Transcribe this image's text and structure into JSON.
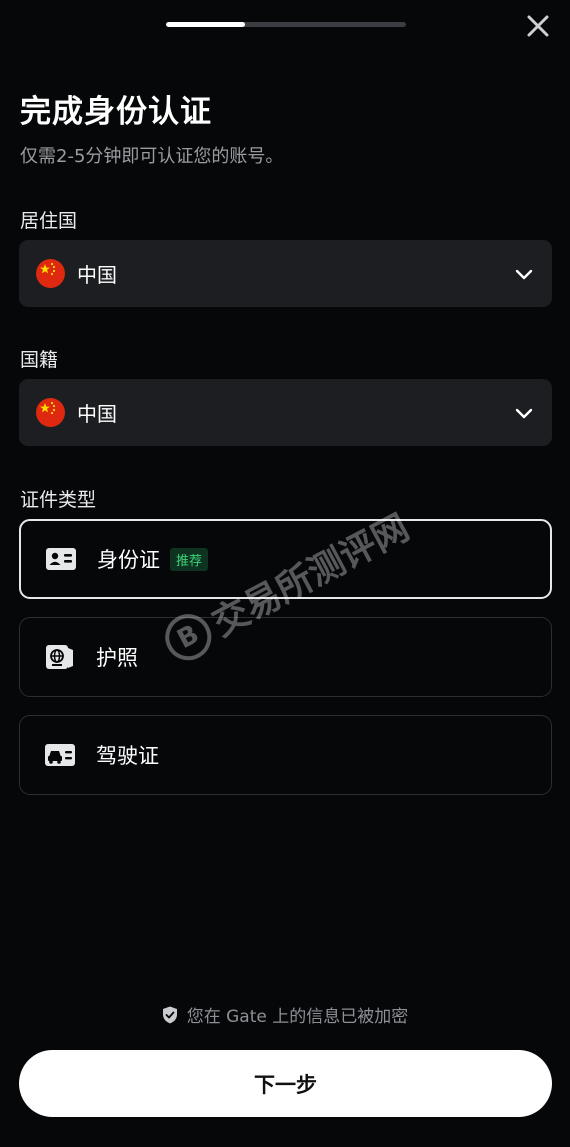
{
  "progress": 0.33,
  "header": {
    "title": "完成身份认证",
    "subtitle": "仅需2-5分钟即可认证您的账号。"
  },
  "residence": {
    "label": "居住国",
    "value": "中国"
  },
  "nationality": {
    "label": "国籍",
    "value": "中国"
  },
  "document_type": {
    "label": "证件类型",
    "options": [
      {
        "label": "身份证",
        "badge": "推荐",
        "selected": true,
        "icon": "id-card-icon"
      },
      {
        "label": "护照",
        "selected": false,
        "icon": "passport-icon"
      },
      {
        "label": "驾驶证",
        "selected": false,
        "icon": "driver-license-icon"
      }
    ]
  },
  "watermark": {
    "logo": "B",
    "text": "交易所测评网"
  },
  "security_note": "您在 Gate 上的信息已被加密",
  "next_button": "下一步",
  "colors": {
    "background": "#050708",
    "field": "#1c1e22",
    "badge_text": "#3fd27a"
  }
}
